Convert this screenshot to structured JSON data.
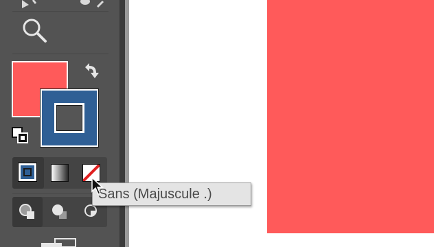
{
  "toolbar": {
    "tools": {
      "zoom": {
        "icon": "magnifier-icon"
      },
      "swap_fill_stroke": {
        "icon": "swap-arrow-icon"
      },
      "default_fill_stroke": {
        "icon": "default-fill-stroke-icon"
      }
    },
    "fill_color": "#ff5a5a",
    "stroke_color": "#2f5f95",
    "color_modes": [
      {
        "name": "Color",
        "icon": "color-mode-icon",
        "active": true
      },
      {
        "name": "Gradient",
        "icon": "gradient-icon",
        "active": false
      },
      {
        "name": "None",
        "icon": "none-icon",
        "active": false
      }
    ],
    "draw_modes": [
      {
        "icon": "draw-normal-icon",
        "active": true
      },
      {
        "icon": "draw-behind-icon",
        "active": false
      },
      {
        "icon": "draw-inside-icon",
        "active": false
      }
    ]
  },
  "tooltip": {
    "text": "Sans (Majuscule .)"
  },
  "canvas": {
    "shape_color": "#ff5a5a"
  }
}
